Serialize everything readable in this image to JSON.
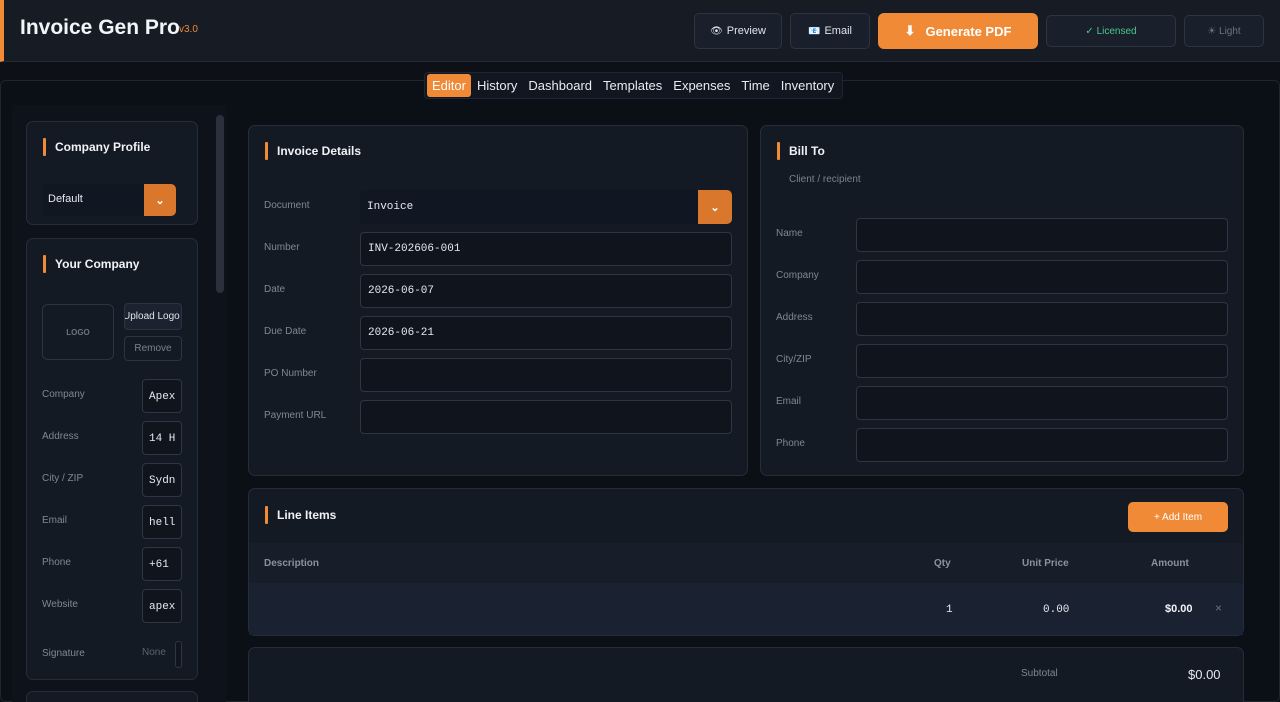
{
  "header": {
    "title": "Invoice Gen Pro",
    "version": "v3.0",
    "preview_icon": "👁",
    "preview_label": "Preview",
    "email_icon": "📧",
    "email_label": "Email",
    "pdf_icon": "⬇",
    "pdf_label": "Generate PDF",
    "licensed_label": "✓ Licensed",
    "theme_label": "☀ Light"
  },
  "tabs": [
    "Editor",
    "History",
    "Dashboard",
    "Templates",
    "Expenses",
    "Time",
    "Inventory"
  ],
  "active_tab": "Editor",
  "company_profile": {
    "title": "Company Profile",
    "selected": "Default"
  },
  "your_company": {
    "title": "Your Company",
    "logo_placeholder": "LOGO",
    "upload_label": "Upload Logo",
    "remove_label": "Remove",
    "fields": [
      {
        "label": "Company",
        "value": "Apex"
      },
      {
        "label": "Address",
        "value": "14 H"
      },
      {
        "label": "City / ZIP",
        "value": "Sydn"
      },
      {
        "label": "Email",
        "value": "hell"
      },
      {
        "label": "Phone",
        "value": "+61"
      },
      {
        "label": "Website",
        "value": "apex"
      }
    ],
    "signature_label": "Signature",
    "signature_value": "None"
  },
  "invoice_details": {
    "title": "Invoice Details",
    "document_label": "Document",
    "document_value": "Invoice",
    "number_label": "Number",
    "number_value": "INV-202606-001",
    "date_label": "Date",
    "date_value": "2026-06-07",
    "due_label": "Due Date",
    "due_value": "2026-06-21",
    "po_label": "PO Number",
    "po_value": "",
    "payment_label": "Payment URL",
    "payment_value": ""
  },
  "bill_to": {
    "title": "Bill To",
    "subtitle": "Client / recipient",
    "fields": [
      "Name",
      "Company",
      "Address",
      "City/ZIP",
      "Email",
      "Phone"
    ]
  },
  "line_items": {
    "title": "Line Items",
    "add_label": "+ Add Item",
    "columns": {
      "description": "Description",
      "qty": "Qty",
      "unit_price": "Unit Price",
      "amount": "Amount"
    },
    "rows": [
      {
        "description": "",
        "qty": "1",
        "unit_price": "0.00",
        "amount": "$0.00",
        "delete": "×"
      }
    ]
  },
  "totals": {
    "subtotal_label": "Subtotal",
    "subtotal_value": "$0.00"
  },
  "colors": {
    "accent": "#f08a37",
    "licensed": "#48c78e",
    "background": "#0d1117"
  }
}
